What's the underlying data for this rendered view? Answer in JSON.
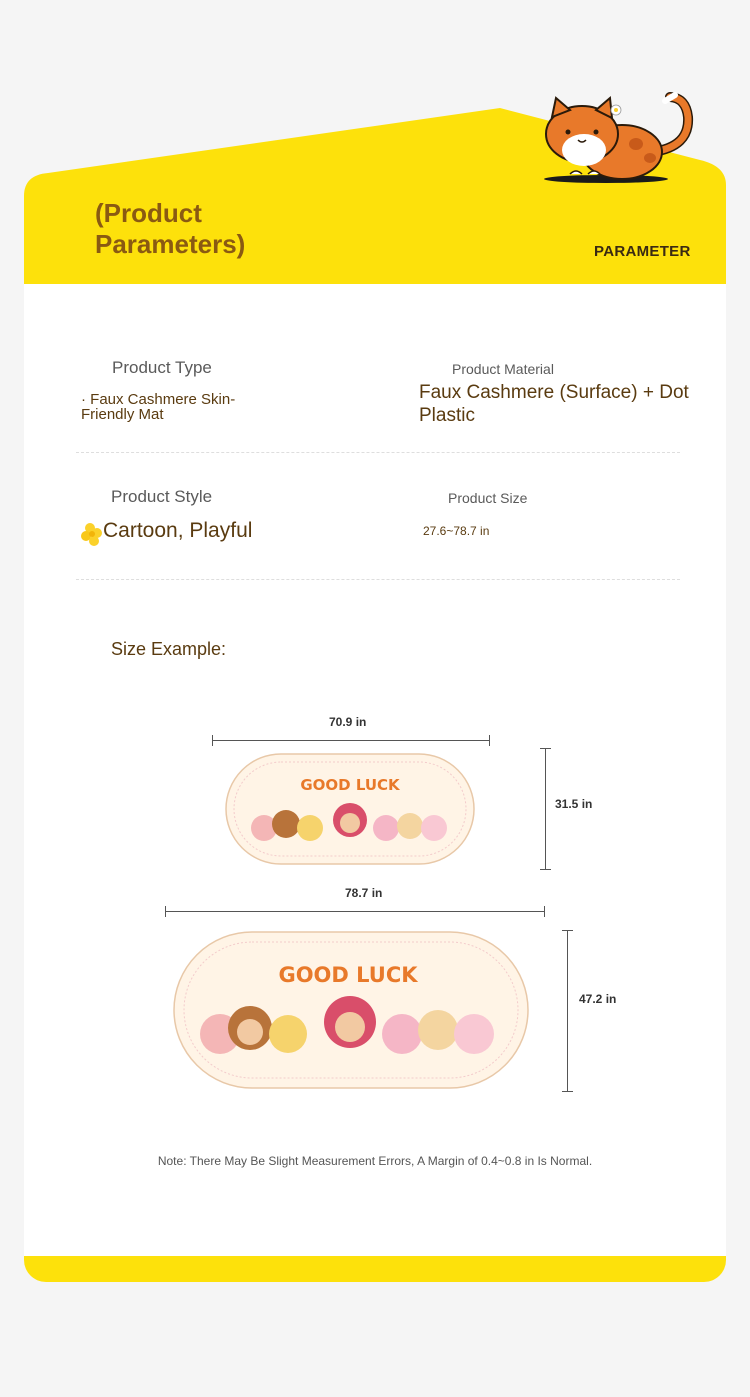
{
  "header": {
    "title": "(Product Parameters)",
    "tag": "PARAMETER"
  },
  "specs": {
    "type_label": "Product Type",
    "type_value": "· Faux Cashmere Skin-Friendly Mat",
    "material_label": "Product Material",
    "material_value": "Faux Cashmere (Surface) + Dot Plastic",
    "style_label": "Product Style",
    "style_value": "Cartoon, Playful",
    "size_label": "Product Size",
    "size_value": "27.6~78.7 in"
  },
  "size_example": {
    "label": "Size Example:",
    "small": {
      "width": "70.9 in",
      "height": "31.5 in",
      "print": "GOOD LUCK"
    },
    "large": {
      "width": "78.7 in",
      "height": "47.2 in",
      "print": "GOOD LUCK"
    }
  },
  "note": "Note: There May Be Slight Measurement Errors, A Margin of 0.4~0.8 in Is Normal.",
  "colors": {
    "brand_yellow": "#fde10b",
    "heading_brown": "#8a5a12",
    "mascot_orange": "#e8792a"
  }
}
